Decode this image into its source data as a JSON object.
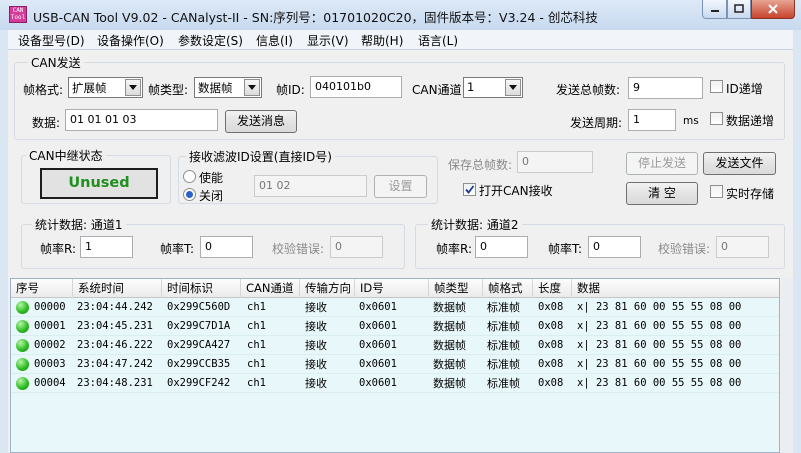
{
  "window": {
    "title": "USB-CAN Tool V9.02 - CANalyst-II - SN:序列号：01701020C20，固件版本号：V3.24 - 创芯科技",
    "icon_text": "CAN Tool"
  },
  "menu": [
    "设备型号(D)",
    "设备操作(O)",
    "参数设定(S)",
    "信息(I)",
    "显示(V)",
    "帮助(H)",
    "语言(L)"
  ],
  "can_send": {
    "group_label": "CAN发送",
    "frame_format_label": "帧格式:",
    "frame_format_value": "扩展帧",
    "frame_type_label": "帧类型:",
    "frame_type_value": "数据帧",
    "frame_id_label": "帧ID:",
    "frame_id_value": "040101b0",
    "channel_label": "CAN通道:",
    "channel_value": "1",
    "total_frames_label": "发送总帧数:",
    "total_frames_value": "9",
    "id_increment_label": "ID递增",
    "data_label": "数据:",
    "data_value": "01 01 01 03",
    "send_button": "发送消息",
    "period_label": "发送周期:",
    "period_value": "1",
    "period_unit": "ms",
    "data_increment_label": "数据递增"
  },
  "relay": {
    "label": "CAN中继状态",
    "status": "Unused",
    "status_color": "#1f8f1f"
  },
  "filter": {
    "label": "接收滤波ID设置(直接ID号)",
    "enable_label": "使能",
    "disable_label": "关闭",
    "selected": "关闭",
    "id_value": "01 02",
    "set_button": "设置"
  },
  "controls": {
    "saved_frames_label": "保存总帧数:",
    "saved_frames_value": "0",
    "stop_send_button": "停止发送",
    "send_file_button": "发送文件",
    "open_receive_label": "打开CAN接收",
    "open_receive_checked": true,
    "clear_button": "清  空",
    "realtime_save_label": "实时存储"
  },
  "stats": [
    {
      "label": "统计数据: 通道1",
      "rate_r_label": "帧率R:",
      "rate_r": "1",
      "rate_t_label": "帧率T:",
      "rate_t": "0",
      "err_label": "校验错误:",
      "err": "0"
    },
    {
      "label": "统计数据: 通道2",
      "rate_r_label": "帧率R:",
      "rate_r": "0",
      "rate_t_label": "帧率T:",
      "rate_t": "0",
      "err_label": "校验错误:",
      "err": "0"
    }
  ],
  "table": {
    "columns": [
      "序号",
      "系统时间",
      "时间标识",
      "CAN通道",
      "传输方向",
      "ID号",
      "帧类型",
      "帧格式",
      "长度",
      "数据"
    ],
    "rows": [
      [
        "00000",
        "23:04:44.242",
        "0x299C560D",
        "ch1",
        "接收",
        "0x0601",
        "数据帧",
        "标准帧",
        "0x08",
        "x| 23 81 60 00 55 55 08 00"
      ],
      [
        "00001",
        "23:04:45.231",
        "0x299C7D1A",
        "ch1",
        "接收",
        "0x0601",
        "数据帧",
        "标准帧",
        "0x08",
        "x| 23 81 60 00 55 55 08 00"
      ],
      [
        "00002",
        "23:04:46.222",
        "0x299CA427",
        "ch1",
        "接收",
        "0x0601",
        "数据帧",
        "标准帧",
        "0x08",
        "x| 23 81 60 00 55 55 08 00"
      ],
      [
        "00003",
        "23:04:47.242",
        "0x299CCB35",
        "ch1",
        "接收",
        "0x0601",
        "数据帧",
        "标准帧",
        "0x08",
        "x| 23 81 60 00 55 55 08 00"
      ],
      [
        "00004",
        "23:04:48.231",
        "0x299CF242",
        "ch1",
        "接收",
        "0x0601",
        "数据帧",
        "标准帧",
        "0x08",
        "x| 23 81 60 00 55 55 08 00"
      ]
    ]
  }
}
